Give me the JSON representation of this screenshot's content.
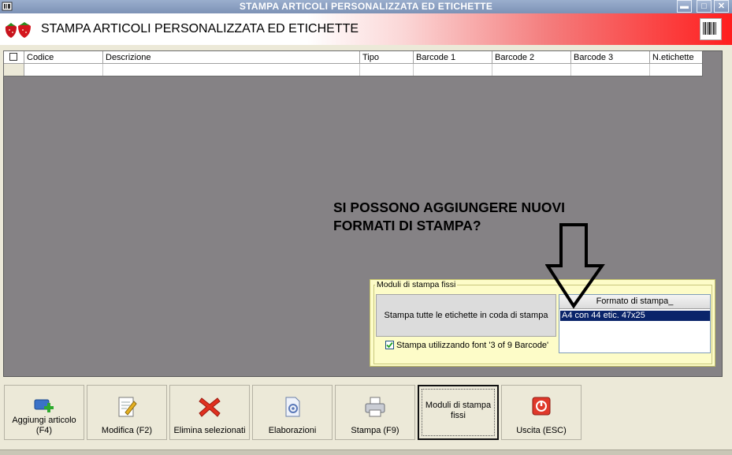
{
  "window": {
    "title": "STAMPA ARTICOLI PERSONALIZZATA ED ETICHETTE",
    "min_label": "▬",
    "max_label": "□",
    "close_label": "✕"
  },
  "banner": {
    "title": "STAMPA ARTICOLI PERSONALIZZATA ED ETICHETTE"
  },
  "grid": {
    "columns": [
      "Codice",
      "Descrizione",
      "Tipo",
      "Barcode 1",
      "Barcode 2",
      "Barcode 3",
      "N.etichette"
    ]
  },
  "annotation": {
    "line1": "SI POSSONO AGGIUNGERE NUOVI",
    "line2": "FORMATI DI STAMPA?"
  },
  "fixed_modules": {
    "legend": "Moduli di stampa fissi",
    "print_all_label": "Stampa tutte le etichette in coda di stampa",
    "font_option_label": "Stampa utilizzando font '3 of 9 Barcode'",
    "font_option_checked": true,
    "format_header": "Formato di stampa_",
    "formats": [
      "A4 con 44 etic. 47x25"
    ]
  },
  "toolbar": {
    "add_line1": "Aggiungi articolo",
    "add_line2": "(F4)",
    "edit": "Modifica (F2)",
    "delete": "Elimina selezionati",
    "process": "Elaborazioni",
    "print": "Stampa (F9)",
    "modules_line1": "Moduli di stampa",
    "modules_line2": "fissi",
    "exit": "Uscita (ESC)"
  },
  "colors": {
    "work_area": "#858285",
    "panel": "#fdfcc8",
    "selected": "#0a246a",
    "delete_red": "#e0301e"
  }
}
